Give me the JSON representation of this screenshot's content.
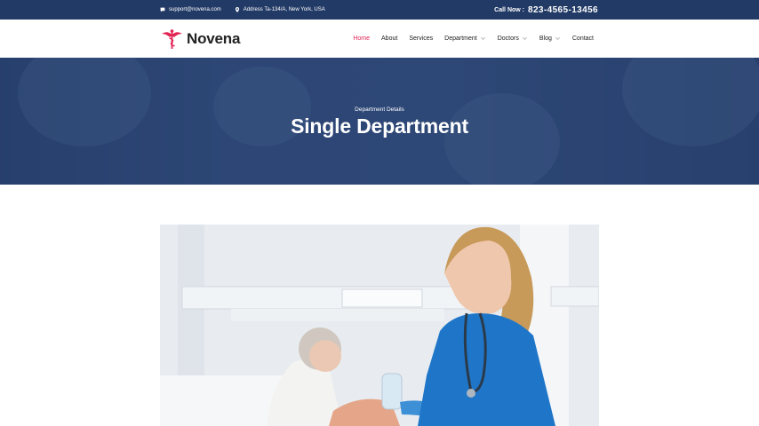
{
  "topbar": {
    "email": "support@novena.com",
    "address": "Address Ta-134/A, New York, USA",
    "call_label": "Call Now :",
    "call_number": "823-4565-13456"
  },
  "brand": {
    "name": "Novena",
    "accent": "#e12454",
    "primary": "#223a66"
  },
  "nav": {
    "items": [
      {
        "label": "Home",
        "active": true
      },
      {
        "label": "About"
      },
      {
        "label": "Services"
      },
      {
        "label": "Department",
        "dropdown": true
      },
      {
        "label": "Doctors",
        "dropdown": true
      },
      {
        "label": "Blog",
        "dropdown": true
      },
      {
        "label": "Contact"
      }
    ]
  },
  "banner": {
    "subtitle": "Department Details",
    "title": "Single Department"
  }
}
